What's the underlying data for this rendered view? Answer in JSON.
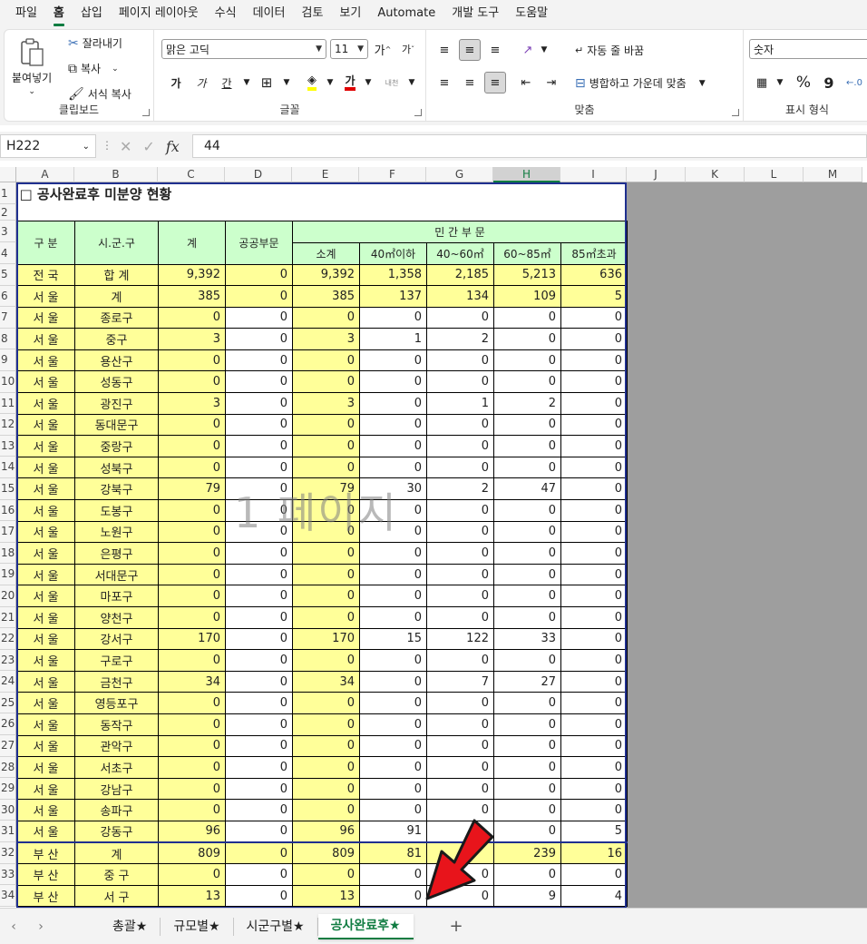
{
  "menu": {
    "tabs": [
      "파일",
      "홈",
      "삽입",
      "페이지 레이아웃",
      "수식",
      "데이터",
      "검토",
      "보기",
      "Automate",
      "개발 도구",
      "도움말"
    ],
    "active_index": 1
  },
  "ribbon": {
    "clipboard": {
      "label": "클립보드",
      "paste": "붙여넣기",
      "cut": "잘라내기",
      "copy": "복사",
      "format_painter": "서식 복사"
    },
    "font": {
      "label": "글꼴",
      "font_name": "맑은 고딕",
      "font_size": "11",
      "grow": "가",
      "shrink": "가",
      "bold": "가",
      "italic": "가",
      "underline": "간",
      "font_color_glyph": "가",
      "phonetic": "내천"
    },
    "alignment": {
      "label": "맞춤",
      "wrap_text": "자동 줄 바꿈",
      "merge_center": "병합하고 가운데 맞춤"
    },
    "number": {
      "label": "표시 형식",
      "format": "숫자",
      "percent": "%",
      "comma": "9"
    }
  },
  "formula_bar": {
    "name_box": "H222",
    "fx": "fx",
    "value": "44"
  },
  "sheet": {
    "columns": [
      "A",
      "B",
      "C",
      "D",
      "E",
      "F",
      "G",
      "H",
      "I",
      "J",
      "K",
      "L",
      "M"
    ],
    "selected_column": "H",
    "row_numbers": [
      "1",
      "2",
      "3",
      "4",
      "5",
      "6",
      "7",
      "8",
      "9",
      "10",
      "11",
      "12",
      "13",
      "14",
      "15",
      "16",
      "17",
      "18",
      "19",
      "20",
      "21",
      "22",
      "23",
      "24",
      "25",
      "26",
      "27",
      "28",
      "29",
      "30",
      "31",
      "32",
      "33",
      "34"
    ],
    "title": "□ 공사완료후 미분양 현황",
    "header": {
      "region": "구 분",
      "district": "시.군.구",
      "total": "계",
      "public": "공공부문",
      "private": "민 간 부 문",
      "private_cols": [
        "소계",
        "40㎡이하",
        "40~60㎡",
        "60~85㎡",
        "85㎡초과"
      ]
    },
    "rows": [
      [
        "전 국",
        "합 계",
        "9,392",
        "0",
        "9,392",
        "1,358",
        "2,185",
        "5,213",
        "636"
      ],
      [
        "서 울",
        "계",
        "385",
        "0",
        "385",
        "137",
        "134",
        "109",
        "5"
      ],
      [
        "서 울",
        "종로구",
        "0",
        "0",
        "0",
        "0",
        "0",
        "0",
        "0"
      ],
      [
        "서 울",
        "중구",
        "3",
        "0",
        "3",
        "1",
        "2",
        "0",
        "0"
      ],
      [
        "서 울",
        "용산구",
        "0",
        "0",
        "0",
        "0",
        "0",
        "0",
        "0"
      ],
      [
        "서 울",
        "성동구",
        "0",
        "0",
        "0",
        "0",
        "0",
        "0",
        "0"
      ],
      [
        "서 울",
        "광진구",
        "3",
        "0",
        "3",
        "0",
        "1",
        "2",
        "0"
      ],
      [
        "서 울",
        "동대문구",
        "0",
        "0",
        "0",
        "0",
        "0",
        "0",
        "0"
      ],
      [
        "서 울",
        "중랑구",
        "0",
        "0",
        "0",
        "0",
        "0",
        "0",
        "0"
      ],
      [
        "서 울",
        "성북구",
        "0",
        "0",
        "0",
        "0",
        "0",
        "0",
        "0"
      ],
      [
        "서 울",
        "강북구",
        "79",
        "0",
        "79",
        "30",
        "2",
        "47",
        "0"
      ],
      [
        "서 울",
        "도봉구",
        "0",
        "0",
        "0",
        "0",
        "0",
        "0",
        "0"
      ],
      [
        "서 울",
        "노원구",
        "0",
        "0",
        "0",
        "0",
        "0",
        "0",
        "0"
      ],
      [
        "서 울",
        "은평구",
        "0",
        "0",
        "0",
        "0",
        "0",
        "0",
        "0"
      ],
      [
        "서 울",
        "서대문구",
        "0",
        "0",
        "0",
        "0",
        "0",
        "0",
        "0"
      ],
      [
        "서 울",
        "마포구",
        "0",
        "0",
        "0",
        "0",
        "0",
        "0",
        "0"
      ],
      [
        "서 울",
        "양천구",
        "0",
        "0",
        "0",
        "0",
        "0",
        "0",
        "0"
      ],
      [
        "서 울",
        "강서구",
        "170",
        "0",
        "170",
        "15",
        "122",
        "33",
        "0"
      ],
      [
        "서 울",
        "구로구",
        "0",
        "0",
        "0",
        "0",
        "0",
        "0",
        "0"
      ],
      [
        "서 울",
        "금천구",
        "34",
        "0",
        "34",
        "0",
        "7",
        "27",
        "0"
      ],
      [
        "서 울",
        "영등포구",
        "0",
        "0",
        "0",
        "0",
        "0",
        "0",
        "0"
      ],
      [
        "서 울",
        "동작구",
        "0",
        "0",
        "0",
        "0",
        "0",
        "0",
        "0"
      ],
      [
        "서 울",
        "관악구",
        "0",
        "0",
        "0",
        "0",
        "0",
        "0",
        "0"
      ],
      [
        "서 울",
        "서초구",
        "0",
        "0",
        "0",
        "0",
        "0",
        "0",
        "0"
      ],
      [
        "서 울",
        "강남구",
        "0",
        "0",
        "0",
        "0",
        "0",
        "0",
        "0"
      ],
      [
        "서 울",
        "송파구",
        "0",
        "0",
        "0",
        "0",
        "0",
        "0",
        "0"
      ],
      [
        "서 울",
        "강동구",
        "96",
        "0",
        "96",
        "91",
        "",
        "0",
        "5"
      ],
      [
        "부 산",
        "계",
        "809",
        "0",
        "809",
        "81",
        "",
        "239",
        "16"
      ],
      [
        "부 산",
        "중 구",
        "0",
        "0",
        "0",
        "0",
        "0",
        "0",
        "0"
      ],
      [
        "부 산",
        "서 구",
        "13",
        "0",
        "13",
        "0",
        "0",
        "9",
        "4"
      ]
    ],
    "watermark": "1 페이지"
  },
  "sheet_tabs": {
    "tabs": [
      "총괄★",
      "규모별★",
      "시군구별★",
      "공사완료후★"
    ],
    "active_index": 3,
    "add": "+"
  },
  "colors": {
    "accent": "#107c41",
    "cell_yellow": "#ffff99",
    "cell_green": "#ccffcc",
    "print_outline": "#1f2f8f",
    "arrow": "#e8141b"
  }
}
